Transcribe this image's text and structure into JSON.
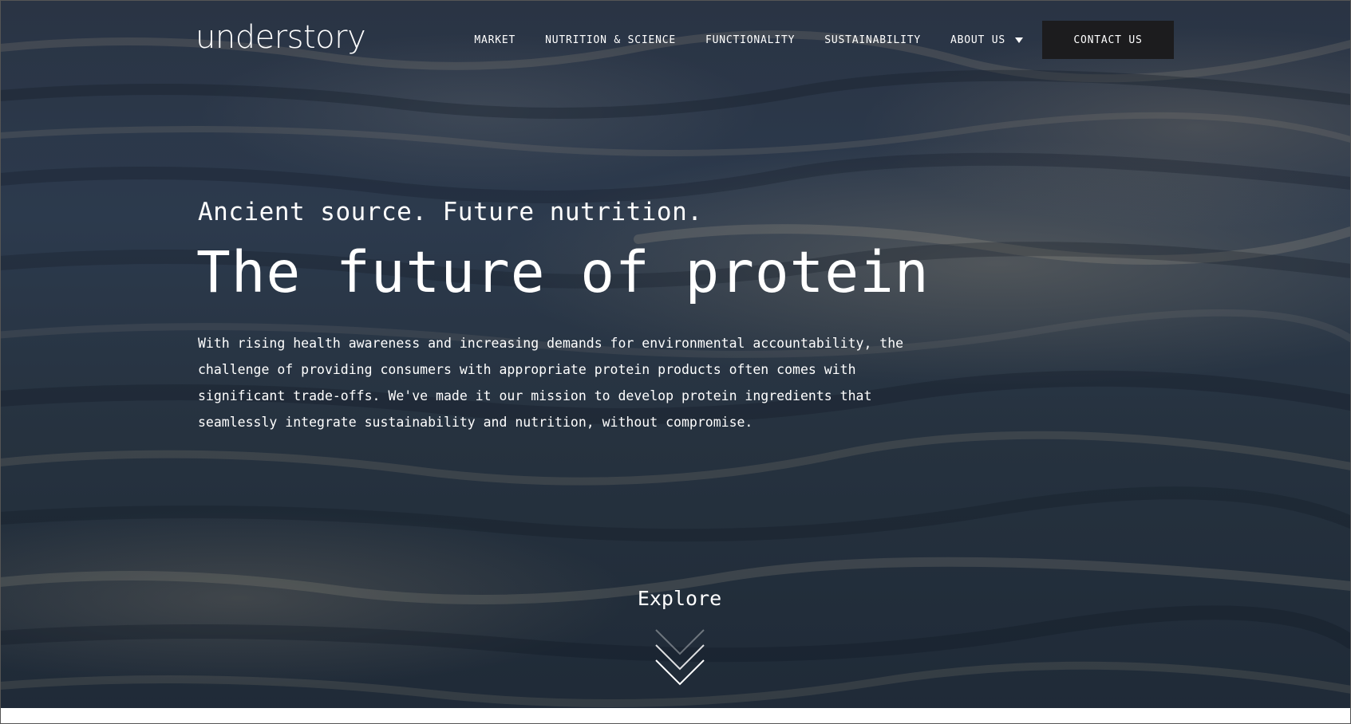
{
  "header": {
    "logo": "understory",
    "nav": [
      {
        "label": "MARKET"
      },
      {
        "label": "NUTRITION & SCIENCE"
      },
      {
        "label": "FUNCTIONALITY"
      },
      {
        "label": "SUSTAINABILITY"
      },
      {
        "label": "ABOUT US",
        "has_dropdown": true
      }
    ],
    "contact_label": "CONTACT US"
  },
  "hero": {
    "tagline": "Ancient source. Future nutrition.",
    "headline": "The future of protein",
    "body": "With rising health awareness and increasing demands for environmental accountability, the challenge of providing consumers with appropriate protein products often comes with significant trade-offs. We've made it our mission to develop protein ingredients that seamlessly integrate sustainability and nutrition, without compromise.",
    "explore_label": "Explore",
    "explore_icon": "chevron-down-icon"
  },
  "colors": {
    "text": "#ffffff",
    "contact_bg": "#1c1c1e",
    "water_dark": "#1f2a37",
    "water_mid": "#2c3a4d"
  }
}
